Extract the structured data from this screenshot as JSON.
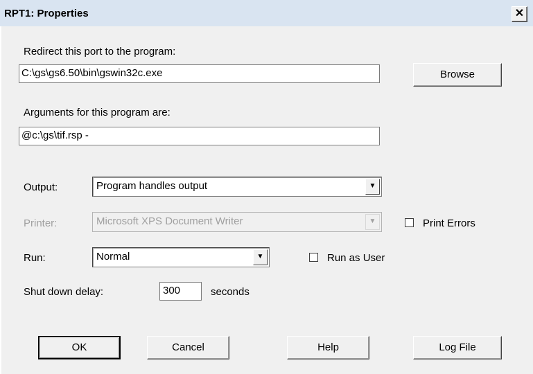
{
  "window": {
    "title": "RPT1: Properties",
    "close_glyph": "✕"
  },
  "redirect": {
    "label": "Redirect this port to the program:",
    "value": "C:\\gs\\gs6.50\\bin\\gswin32c.exe",
    "browse_label": "Browse"
  },
  "arguments": {
    "label": "Arguments for this program are:",
    "value": "@c:\\gs\\tif.rsp -"
  },
  "output": {
    "label": "Output:",
    "selected": "Program handles output"
  },
  "printer": {
    "label": "Printer:",
    "selected": "Microsoft XPS Document Writer",
    "enabled": false,
    "print_errors_label": "Print Errors",
    "print_errors_checked": false
  },
  "run": {
    "label": "Run:",
    "selected": "Normal",
    "run_as_user_label": "Run as User",
    "run_as_user_checked": false
  },
  "shutdown": {
    "label": "Shut down delay:",
    "value": "300",
    "unit": "seconds"
  },
  "buttons": {
    "ok": "OK",
    "cancel": "Cancel",
    "help": "Help",
    "log_file": "Log File"
  },
  "colors": {
    "titlebar": "#d9e4f1",
    "dialog_bg": "#f0f0f0",
    "disabled_text": "#a0a0a0"
  }
}
